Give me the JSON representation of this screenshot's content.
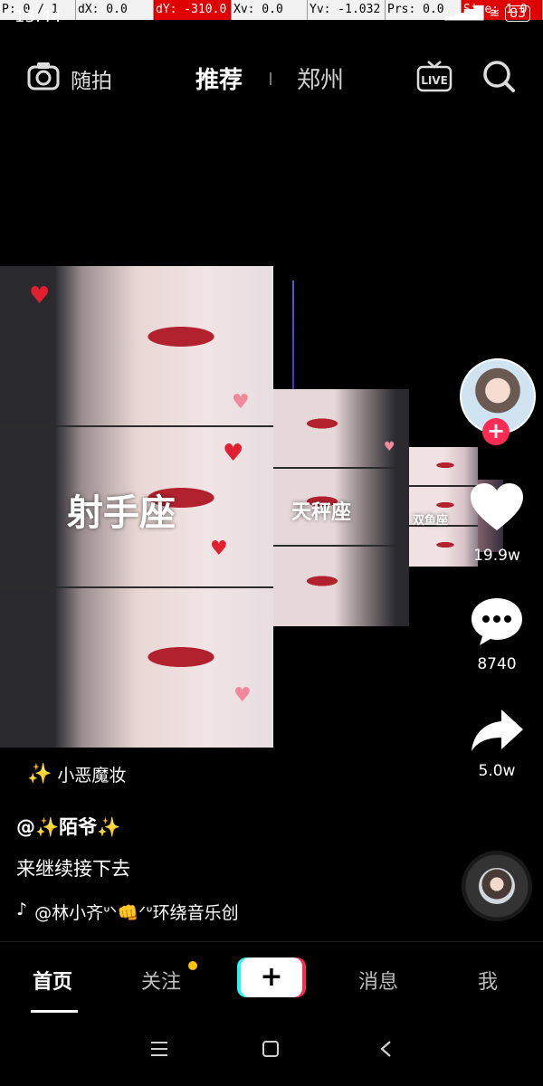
{
  "debug_bar": {
    "pointer": "P: 0 / 1",
    "dx": "dX: 0.0",
    "dy": "dY: -310.0",
    "xv": "Xv: 0.0",
    "yv": "Yv: -1.032",
    "prs": "Prs: 0.0",
    "size": "Size: 1.0"
  },
  "status_bar": {
    "time": "13:44",
    "battery": "83"
  },
  "top_nav": {
    "camera_label": "随拍",
    "tab_recommend": "推荐",
    "tab_city": "郑州",
    "live_label": "LIVE"
  },
  "video": {
    "zodiac_large": "射手座",
    "zodiac_mid": "天秤座",
    "zodiac_small": "双鱼座"
  },
  "rail": {
    "likes": "19.9w",
    "comments": "8740",
    "shares": "5.0w"
  },
  "info": {
    "effect_name": "小恶魔妆",
    "author": "@✨陌爷✨",
    "caption": "来继续接下去",
    "music": "@林小齐ᐡᐠ👊ᐟᐡ环绕音乐创"
  },
  "bottom_nav": {
    "home": "首页",
    "follow": "关注",
    "create": "+",
    "inbox": "消息",
    "me": "我"
  },
  "colors": {
    "accent_red": "#fe2c55",
    "accent_cyan": "#24f6f0",
    "notice_dot": "#f9c10e"
  }
}
